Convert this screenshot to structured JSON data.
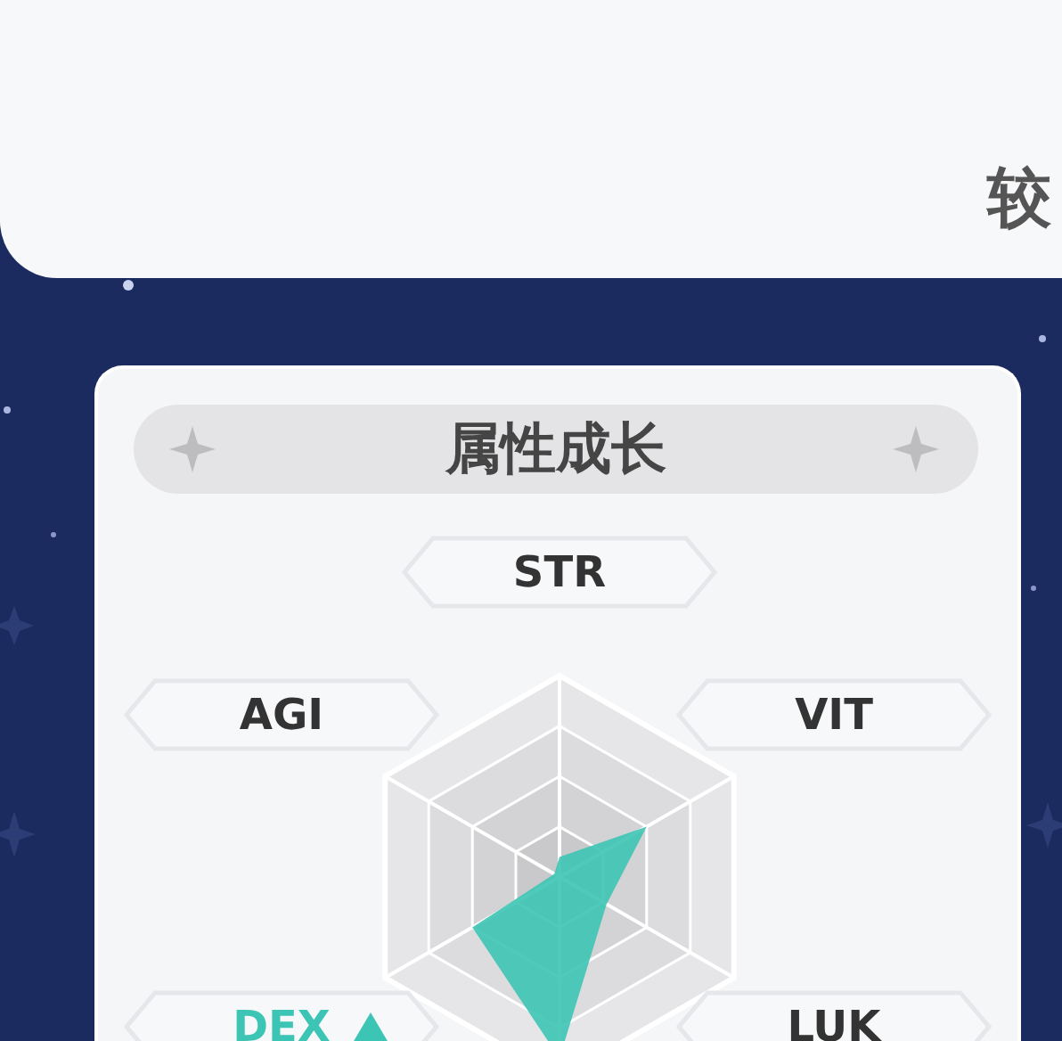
{
  "top_card": {
    "text": "较"
  },
  "panel": {
    "title": "属性成长",
    "stats": [
      {
        "label": "STR",
        "boosted": false
      },
      {
        "label": "AGI",
        "boosted": false
      },
      {
        "label": "VIT",
        "boosted": false
      },
      {
        "label": "DEX",
        "boosted": true
      },
      {
        "label": "LUK",
        "boosted": false
      }
    ]
  }
}
